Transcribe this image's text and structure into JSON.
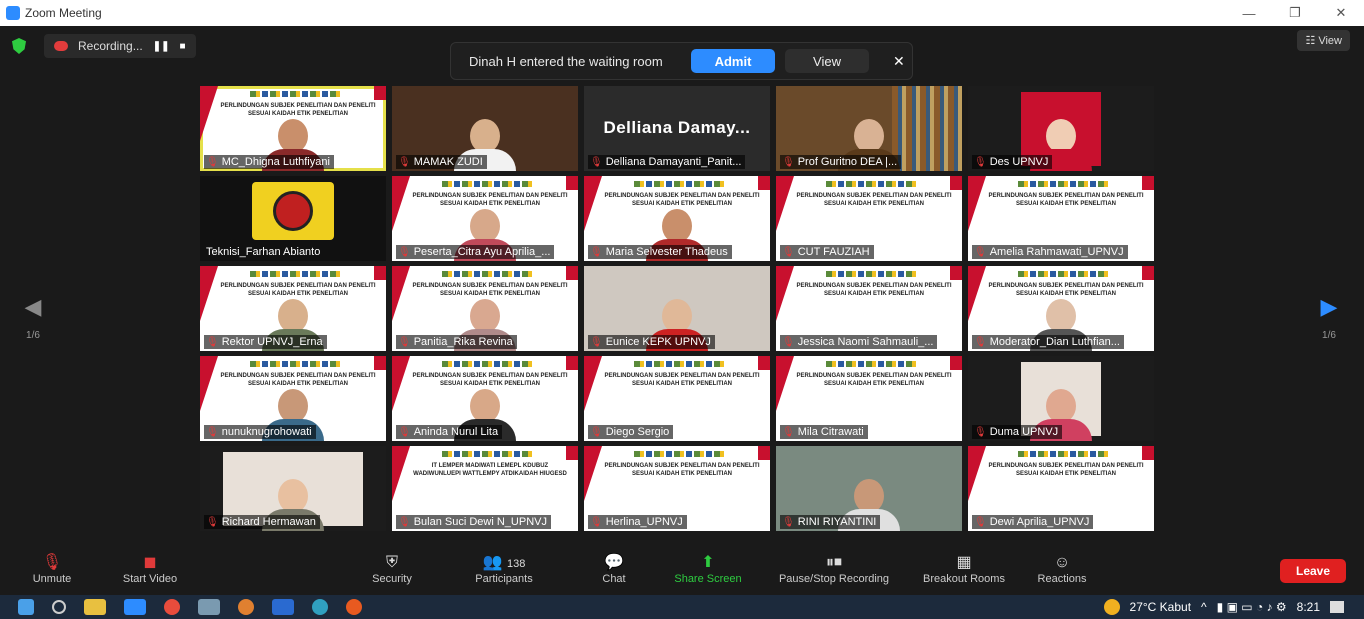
{
  "window": {
    "title": "Zoom Meeting",
    "min": "—",
    "max": "❐",
    "close": "✕"
  },
  "recording": {
    "label": "Recording...",
    "pause": "❚❚",
    "stop": "■"
  },
  "notification": {
    "message": "Dinah H entered the waiting room",
    "admit": "Admit",
    "view": "View",
    "close": "✕"
  },
  "view_button": "☷ View",
  "pager": {
    "left": "1/6",
    "right": "1/6",
    "prev_glyph": "◀",
    "next_glyph": "▶"
  },
  "slide_title": "PERLINDUNGAN SUBJEK PENELITIAN DAN PENELITI SESUAI KAIDAH ETIK PENELITIAN",
  "slide_title_alt": "IT LEMPER MADIWATI LEMEPL KDUBUZ WADIWUNLUEPI WATTLEMPY ATDIKAIDAH HIUGESD",
  "big_name_tile": "Delliana Damay...",
  "participants": [
    {
      "name": "MC_Dhigna Luthfiyani",
      "kind": "slide",
      "skin": "#c98f6b",
      "top": "#8a2a2a",
      "active": true
    },
    {
      "name": "MAMAK ZUDI",
      "kind": "room",
      "skin": "#d8b08c",
      "top": "#f2f2f2"
    },
    {
      "name": "Delliana Damayanti_Panit...",
      "kind": "name"
    },
    {
      "name": "Prof Guritno DEA |...",
      "kind": "books",
      "skin": "#d9b294",
      "top": "#5a3a1a"
    },
    {
      "name": "Des UPNVJ",
      "kind": "photo",
      "skin": "#f0cdb4",
      "top": "#c8102e"
    },
    {
      "name": "Teknisi_Farhan Abianto",
      "kind": "logo"
    },
    {
      "name": "Peserta_Citra Ayu Aprilia_...",
      "kind": "slide",
      "skin": "#d7a88a",
      "top": "#c04a5a"
    },
    {
      "name": "Maria Selvester Thadeus",
      "kind": "slide",
      "skin": "#c98f6b",
      "top": "#b02a2a"
    },
    {
      "name": "CUT FAUZIAH",
      "kind": "slide-empty"
    },
    {
      "name": "Amelia Rahmawati_UPNVJ",
      "kind": "slide-empty"
    },
    {
      "name": "Rektor UPNVJ_Erna",
      "kind": "slide",
      "skin": "#d8b08c",
      "top": "#6a7a5a"
    },
    {
      "name": "Panitia_Rika Revina",
      "kind": "slide",
      "skin": "#d9a890",
      "top": "#b08a8a"
    },
    {
      "name": "Eunice KEPK UPNVJ",
      "kind": "room",
      "skin": "#e0b898",
      "top": "#cc2222"
    },
    {
      "name": "Jessica Naomi Sahmauli_...",
      "kind": "slide-empty"
    },
    {
      "name": "Moderator_Dian Luthfian...",
      "kind": "slide",
      "skin": "#e0c0a8",
      "top": "#555555"
    },
    {
      "name": "nunuknugrohowati",
      "kind": "slide",
      "skin": "#c89878",
      "top": "#3a6a8a"
    },
    {
      "name": "Aninda Nurul Lita",
      "kind": "slide",
      "skin": "#d8a888",
      "top": "#2a2a2a"
    },
    {
      "name": "Diego Sergio",
      "kind": "slide-empty"
    },
    {
      "name": "Mila Citrawati",
      "kind": "slide-empty"
    },
    {
      "name": "Duma UPNVJ",
      "kind": "photo",
      "skin": "#e0a890",
      "top": "#d04060"
    },
    {
      "name": "Richard Hermawan",
      "kind": "photo",
      "skin": "#e8c0a0",
      "top": "#7a7a6a"
    },
    {
      "name": "Bulan Suci Dewi N_UPNVJ",
      "kind": "slide-alt"
    },
    {
      "name": "Herlina_UPNVJ",
      "kind": "slide-empty"
    },
    {
      "name": "RINI RIYANTINI",
      "kind": "room",
      "skin": "#c89878",
      "top": "#e0e0e0"
    },
    {
      "name": "Dewi Aprilia_UPNVJ",
      "kind": "slide-empty"
    }
  ],
  "toolbar": {
    "unmute": "Unmute",
    "start_video": "Start Video",
    "security": "Security",
    "participants": "Participants",
    "participants_count": "138",
    "chat": "Chat",
    "share_screen": "Share Screen",
    "pause_stop_recording": "Pause/Stop Recording",
    "breakout_rooms": "Breakout Rooms",
    "reactions": "Reactions",
    "leave": "Leave"
  },
  "taskbar": {
    "weather": "27°C Kabut",
    "time": "8:21"
  },
  "colors": {
    "accent": "#2d8cff",
    "leave": "#e02020",
    "share": "#2ecc40",
    "active_speaker": "#e5e04a"
  }
}
